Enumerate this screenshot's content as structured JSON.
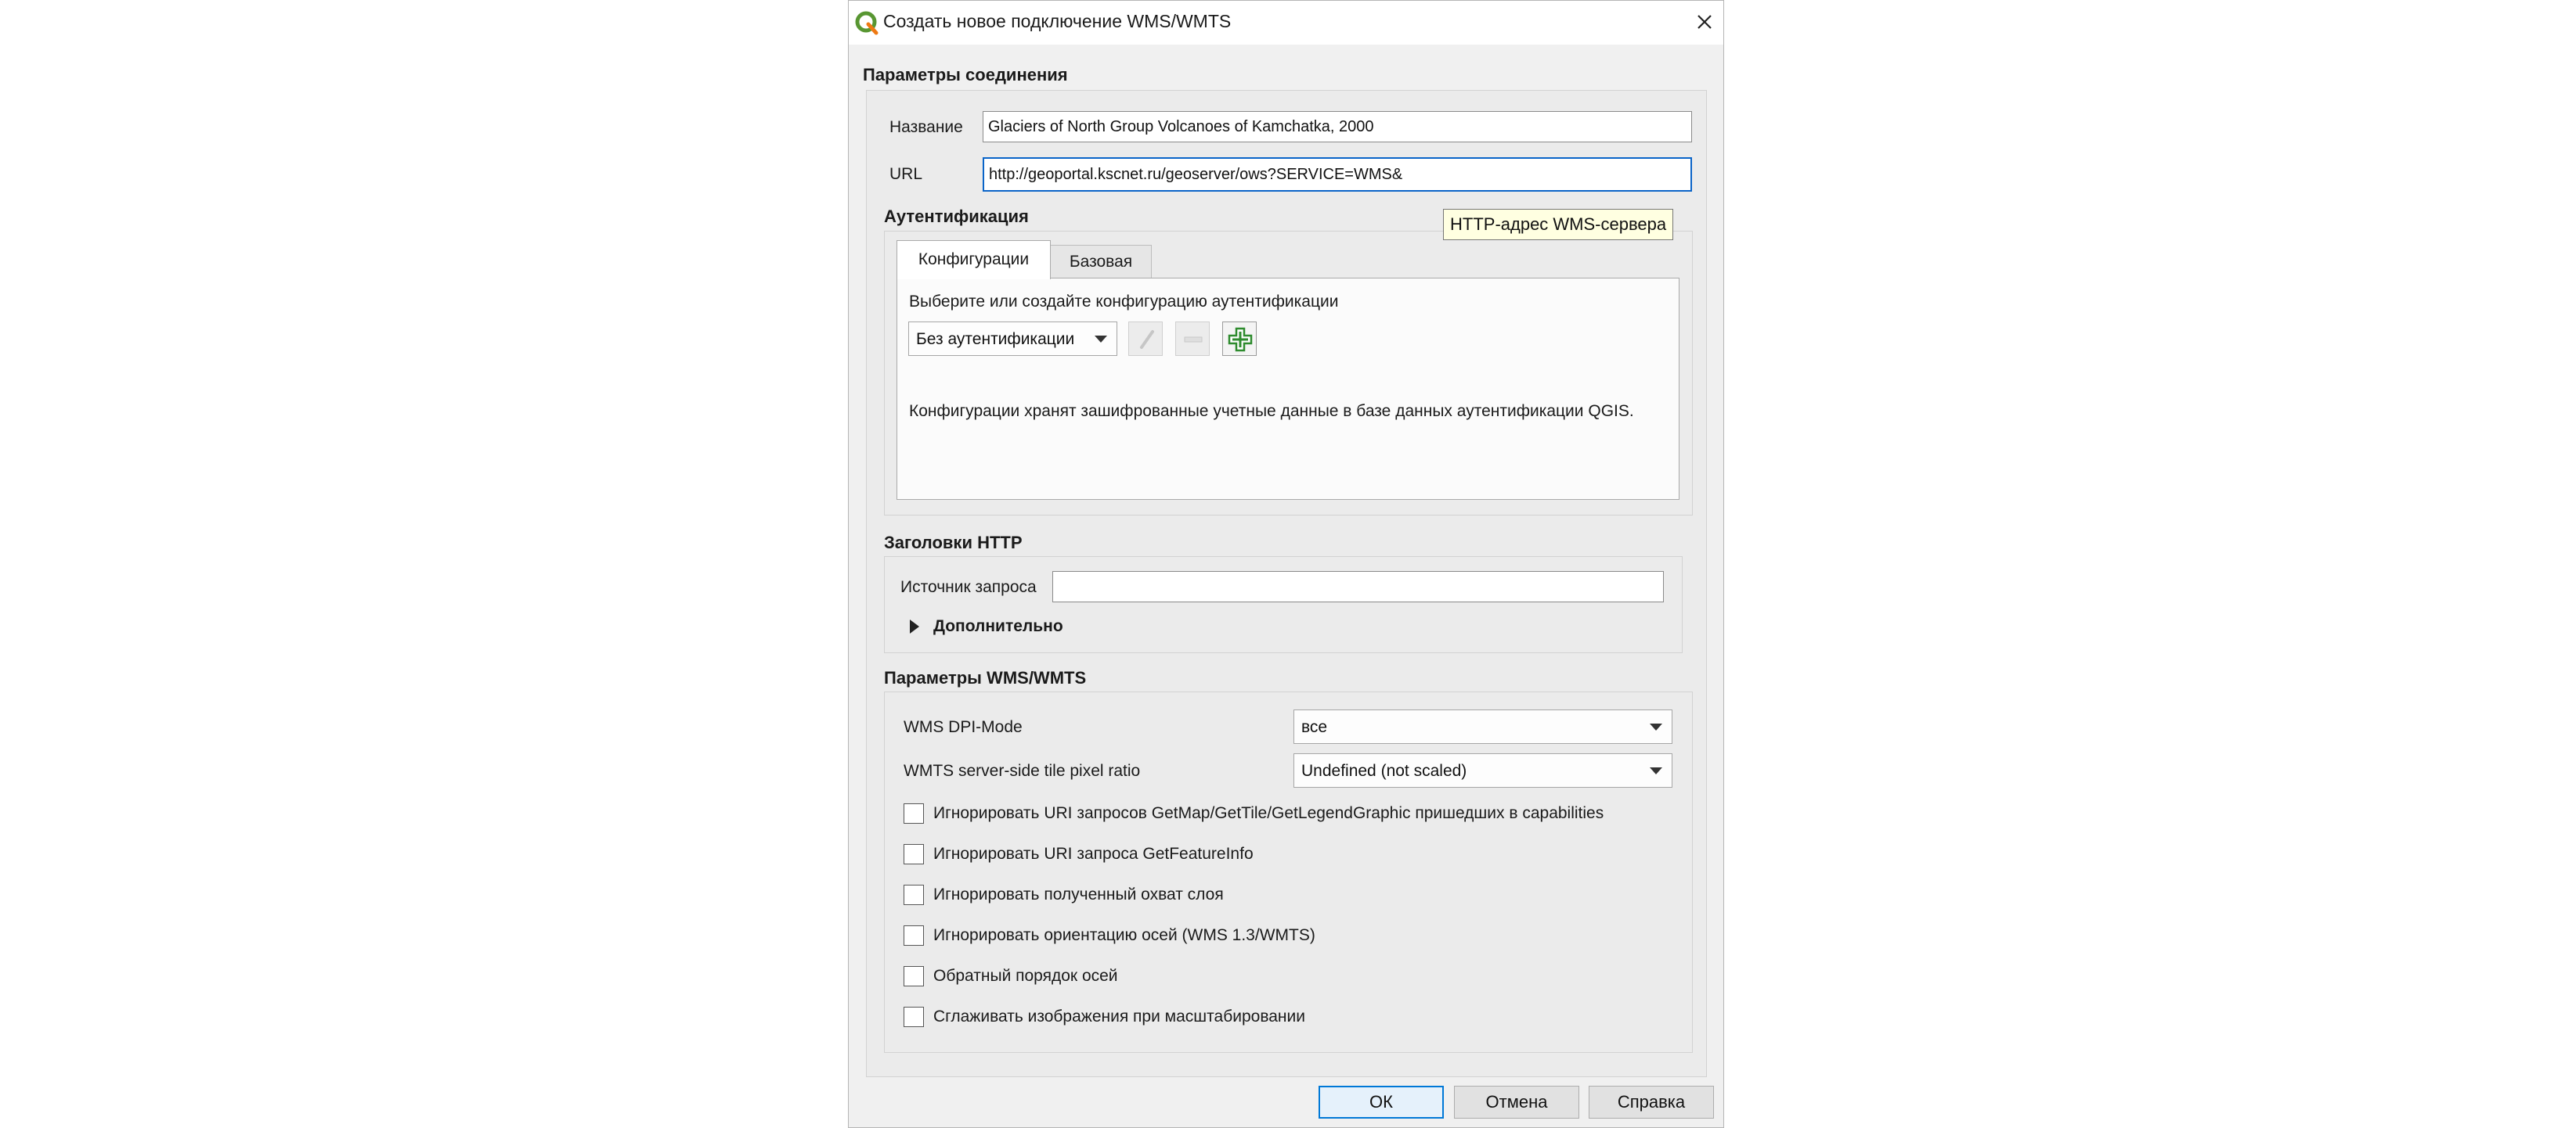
{
  "window": {
    "title": "Создать новое подключение WMS/WMTS",
    "icon": "qgis-logo-icon",
    "close_icon": "close-icon"
  },
  "connection": {
    "group_title": "Параметры соединения",
    "name_label": "Название",
    "name_value": "Glaciers of North Group Volcanoes of Kamchatka, 2000",
    "url_label": "URL",
    "url_value": "http://geoportal.kscnet.ru/geoserver/ows?SERVICE=WMS&",
    "url_tooltip": "HTTP-адрес WMS-сервера"
  },
  "auth": {
    "group_title": "Аутентификация",
    "tabs": [
      {
        "label": "Конфигурации",
        "active": true
      },
      {
        "label": "Базовая",
        "active": false
      }
    ],
    "select_prompt": "Выберите или создайте конфигурацию аутентификации",
    "config_combo": "Без аутентификации",
    "tool_icons": [
      "edit-pencil-icon",
      "remove-minus-icon",
      "add-plus-icon"
    ],
    "info_text": "Конфигурации хранят зашифрованные учетные данные в базе данных аутентификации QGIS."
  },
  "http": {
    "group_title": "Заголовки HTTP",
    "referer_label": "Источник запроса",
    "referer_value": "",
    "advanced_label": "Дополнительно"
  },
  "wms": {
    "group_title": "Параметры WMS/WMTS",
    "dpi_label": "WMS DPI-Mode",
    "dpi_value": "все",
    "tile_label": "WMTS server-side tile pixel ratio",
    "tile_value": "Undefined (not scaled)",
    "options": [
      {
        "label": "Игнорировать URI запросов GetMap/GetTile/GetLegendGraphic пришедших в capabilities",
        "checked": false
      },
      {
        "label": "Игнорировать URI запроса GetFeatureInfo",
        "checked": false
      },
      {
        "label": "Игнорировать полученный охват слоя",
        "checked": false
      },
      {
        "label": "Игнорировать ориентацию осей (WMS 1.3/WMTS)",
        "checked": false
      },
      {
        "label": "Обратный порядок осей",
        "checked": false
      },
      {
        "label": "Сглаживать изображения при масштабировании",
        "checked": false
      }
    ]
  },
  "buttons": {
    "ok": "ОК",
    "cancel": "Отмена",
    "help": "Справка"
  },
  "colors": {
    "focus": "#0a64c8",
    "default_button": "#0078d7",
    "plus_green": "#2e8b2e"
  }
}
